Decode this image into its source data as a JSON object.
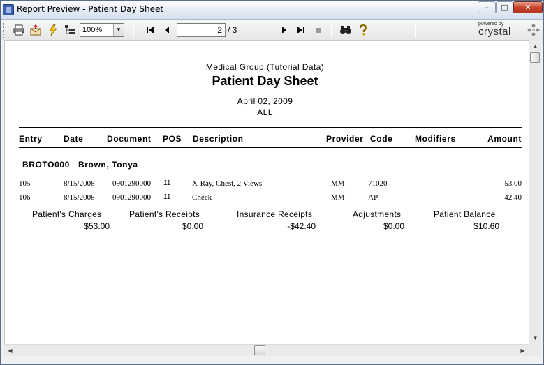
{
  "window": {
    "title": "Report Preview - Patient Day Sheet",
    "min": "–",
    "max": "□",
    "close": "✕"
  },
  "toolbar": {
    "zoom": "100%",
    "page_current": "2",
    "page_total": "/ 3",
    "brand_top": "powered by",
    "brand": "crystal"
  },
  "report": {
    "org": "Medical Group (Tutorial Data)",
    "title": "Patient Day Sheet",
    "date": "April 02, 2009",
    "filter": "ALL",
    "columns": [
      "Entry",
      "Date",
      "Document",
      "POS",
      "Description",
      "Provider",
      "Code",
      "Modifiers",
      "Amount"
    ],
    "patient": {
      "id": "BROTO000",
      "name": "Brown, Tonya"
    },
    "rows": [
      {
        "entry": "105",
        "date": "8/15/2008",
        "document": "0901290000",
        "pos": "11",
        "description": "X-Ray, Chest, 2 Views",
        "provider": "MM",
        "code": "71020",
        "amount": "53.00"
      },
      {
        "entry": "106",
        "date": "8/15/2008",
        "document": "0901290000",
        "pos": "11",
        "description": "Check",
        "provider": "MM",
        "code": "AP",
        "amount": "-42.40"
      }
    ],
    "summary": {
      "labels": [
        "Patient's Charges",
        "Patient's Receipts",
        "Insurance Receipts",
        "Adjustments",
        "Patient Balance"
      ],
      "values": [
        "$53.00",
        "$0.00",
        "-$42.40",
        "$0.00",
        "$10.60"
      ]
    }
  }
}
